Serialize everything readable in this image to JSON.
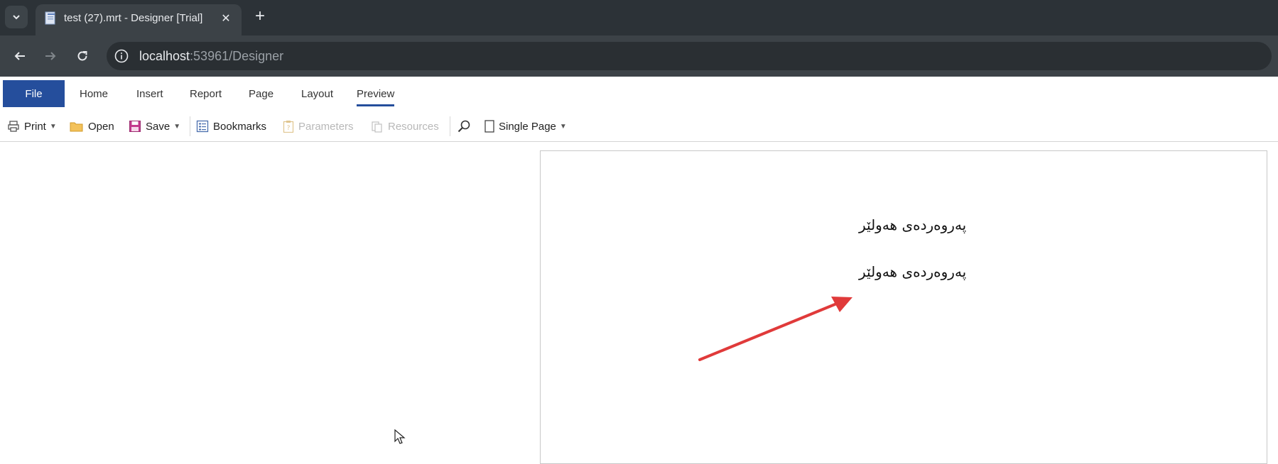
{
  "browser": {
    "tab_title": "test (27).mrt - Designer [Trial]",
    "url_host": "localhost",
    "url_rest": ":53961/Designer"
  },
  "ribbon": {
    "tabs": [
      "File",
      "Home",
      "Insert",
      "Report",
      "Page",
      "Layout",
      "Preview"
    ],
    "active_tab": "Preview"
  },
  "toolbar": {
    "print": "Print",
    "open": "Open",
    "save": "Save",
    "bookmarks": "Bookmarks",
    "parameters": "Parameters",
    "resources": "Resources",
    "view_mode": "Single Page"
  },
  "report": {
    "line1": "پەروەردەی هەولێر",
    "line2": "پەروەردەی هەولێر"
  },
  "colors": {
    "accent": "#254e9c",
    "arrow": "#e03a3a",
    "chrome_dark": "#2c3237"
  }
}
